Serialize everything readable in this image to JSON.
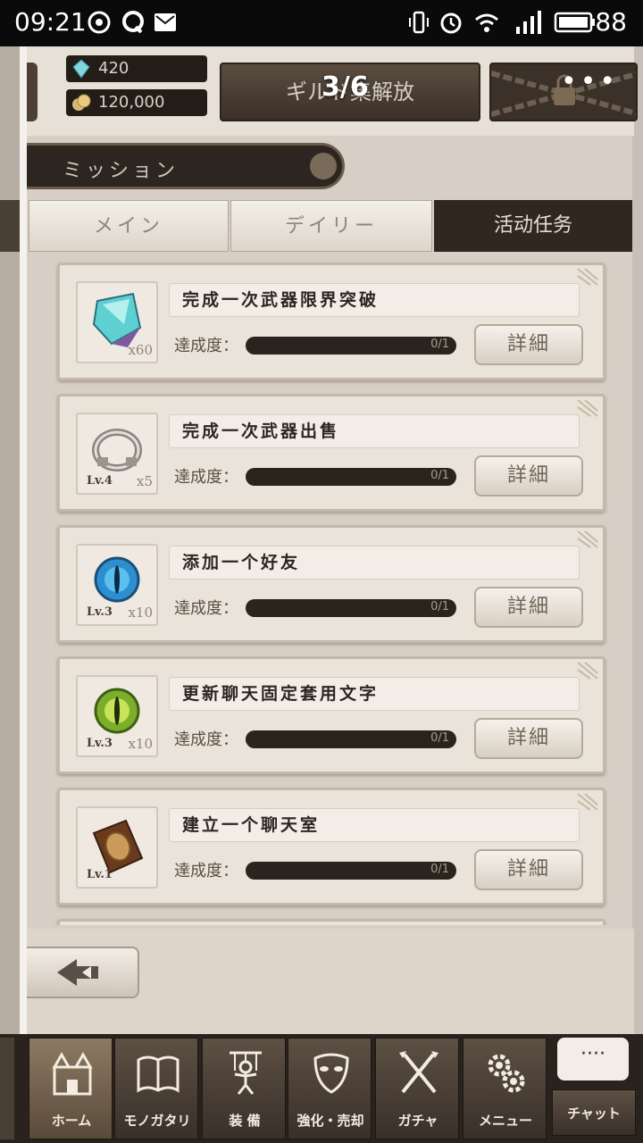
{
  "status_bar": {
    "time": "09:21",
    "battery": "88"
  },
  "topbar": {
    "crystals": "420",
    "coins": "120,000",
    "guild_button": "ギルド集解放",
    "page_counter": "3/6",
    "more": "•••"
  },
  "mission_header": {
    "label": "ミッション"
  },
  "tabs": [
    {
      "label": "メイン",
      "active": false
    },
    {
      "label": "デイリー",
      "active": false
    },
    {
      "label": "活动任务",
      "active": true
    }
  ],
  "missions": [
    {
      "title": "完成一次武器限界突破",
      "progress_label": "達成度：",
      "progress_text": "0/1",
      "progress": 0,
      "detail_label": "詳細",
      "item": "crystal-shard-icon",
      "level": "",
      "quantity": "x60"
    },
    {
      "title": "完成一次武器出售",
      "progress_label": "達成度：",
      "progress_text": "0/1",
      "progress": 0,
      "detail_label": "詳細",
      "item": "ring-icon",
      "level": "Lv.4",
      "quantity": "x5"
    },
    {
      "title": "添加一个好友",
      "progress_label": "達成度：",
      "progress_text": "0/1",
      "progress": 0,
      "detail_label": "詳細",
      "item": "blue-eye-gem-icon",
      "level": "Lv.3",
      "quantity": "x10"
    },
    {
      "title": "更新聊天固定套用文字",
      "progress_label": "達成度：",
      "progress_text": "0/1",
      "progress": 0,
      "detail_label": "詳細",
      "item": "green-eye-gem-icon",
      "level": "Lv.3",
      "quantity": "x10"
    },
    {
      "title": "建立一个聊天室",
      "progress_label": "達成度：",
      "progress_text": "0/1",
      "progress": 0,
      "detail_label": "詳細",
      "item": "tome-icon",
      "level": "Lv.1",
      "quantity": ""
    }
  ],
  "bottom_nav": [
    {
      "label": "ホーム",
      "icon": "castle-icon",
      "active": true
    },
    {
      "label": "モノガタリ",
      "icon": "book-icon",
      "active": false
    },
    {
      "label": "装 備",
      "icon": "puppet-icon",
      "active": false
    },
    {
      "label": "強化・売却",
      "icon": "mask-icon",
      "active": false
    },
    {
      "label": "ガチャ",
      "icon": "crossed-weapons-icon",
      "active": false
    },
    {
      "label": "メニュー",
      "icon": "gears-icon",
      "active": false
    }
  ],
  "chat": {
    "bubble": "····",
    "label": "チャット"
  },
  "colors": {
    "panel": "#e9e3da",
    "dark": "#2a231e",
    "active_tab": "#302820"
  }
}
